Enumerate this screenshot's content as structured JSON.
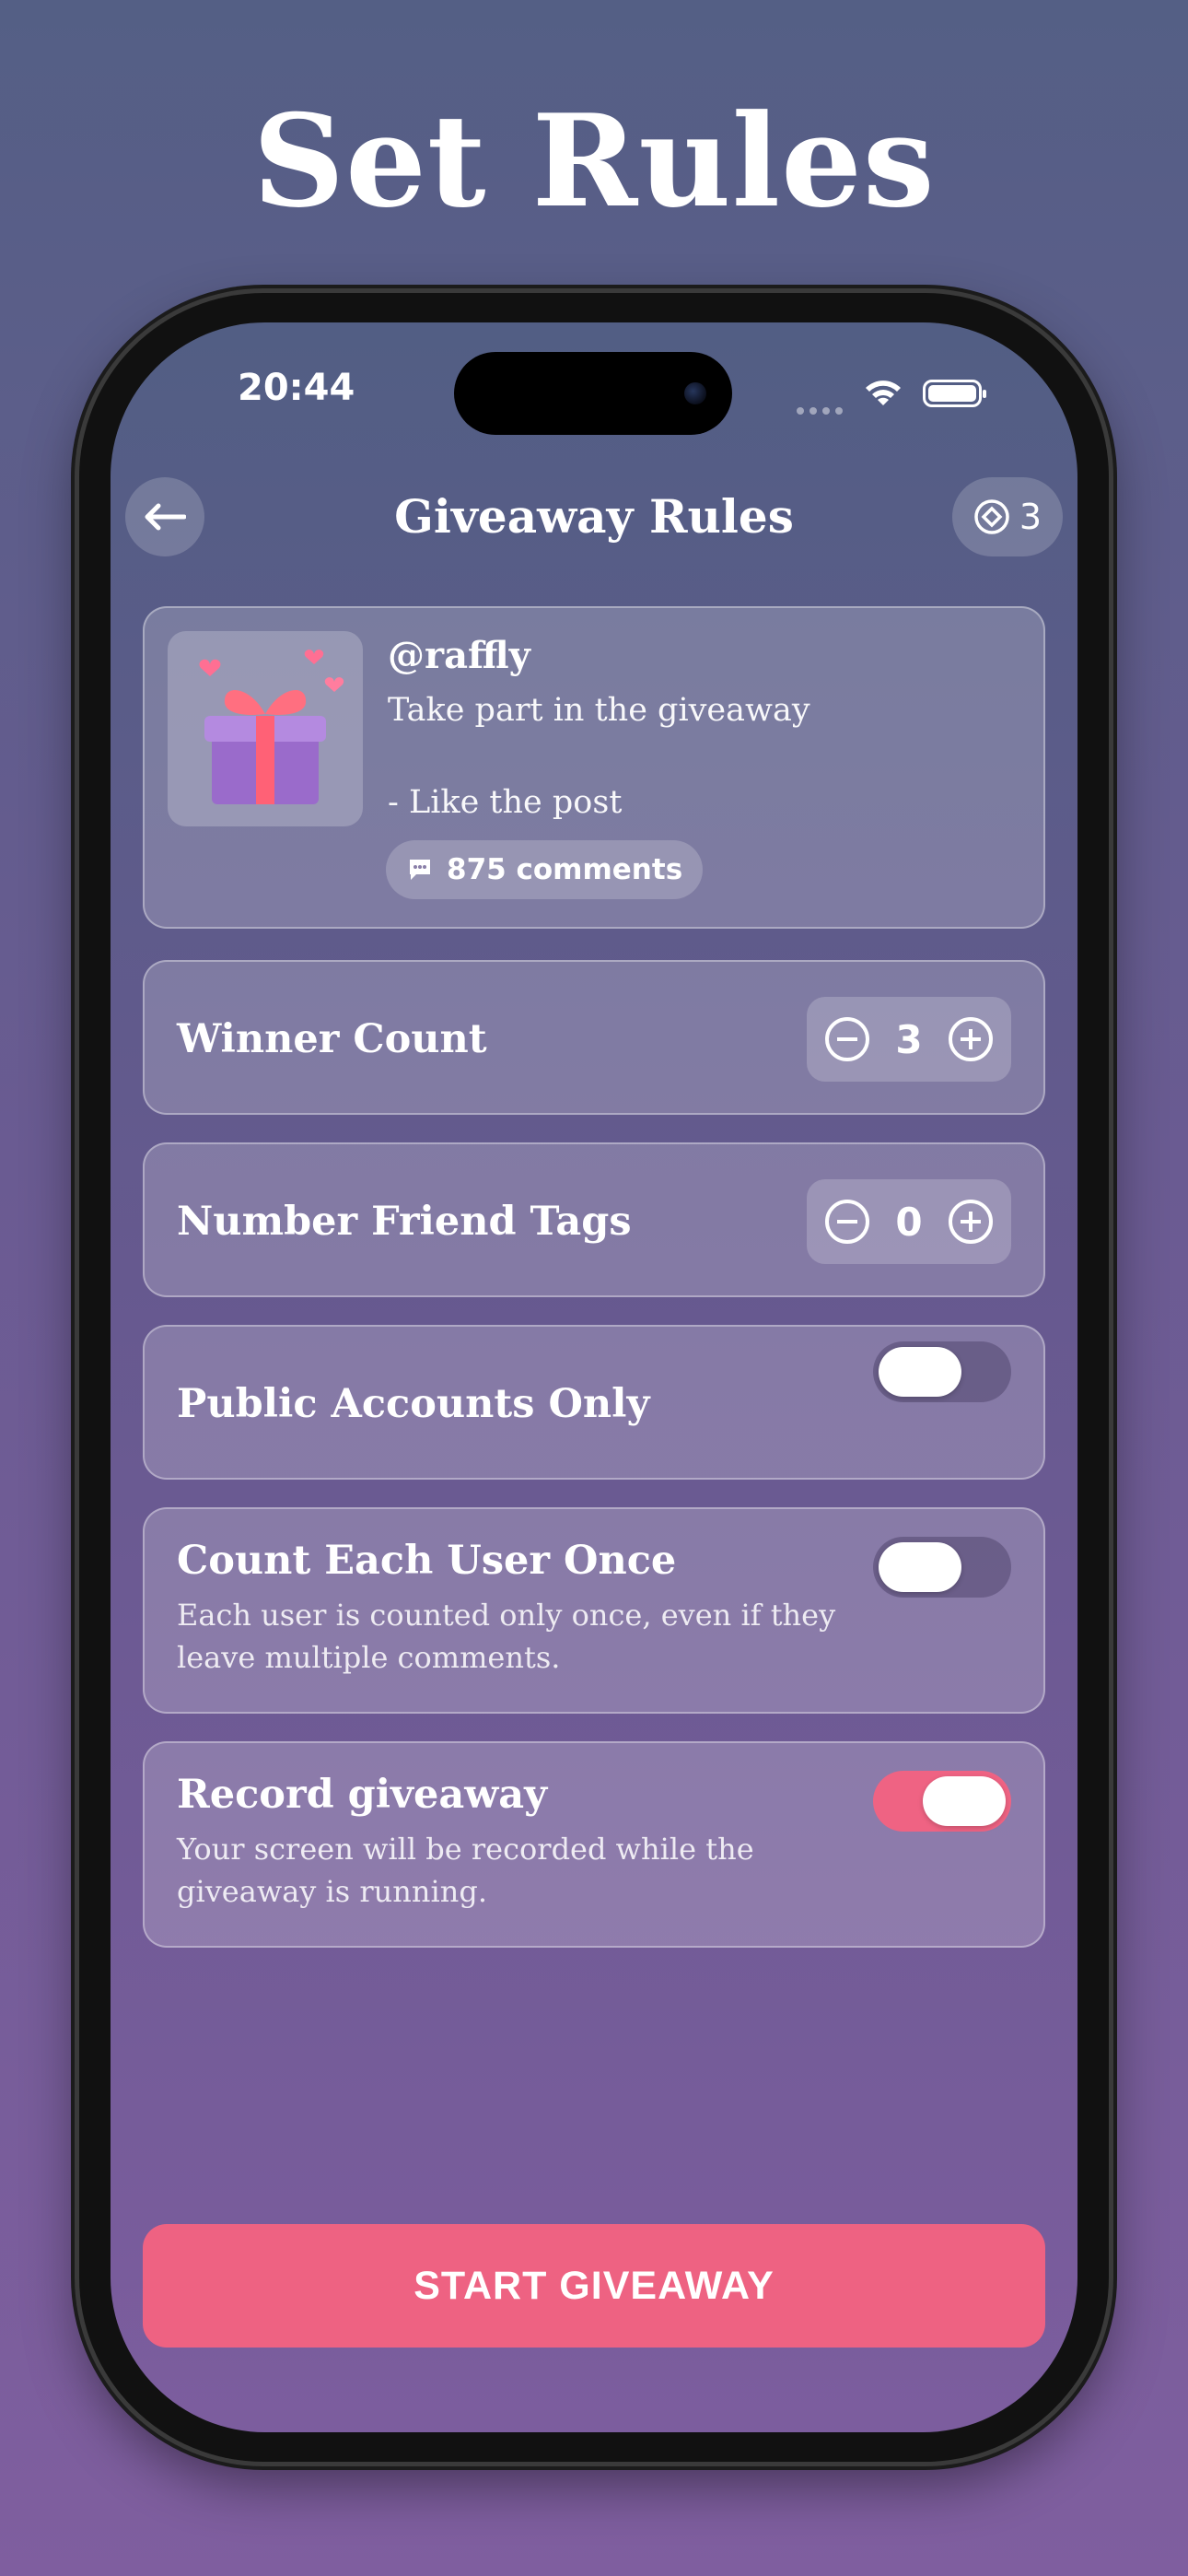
{
  "headline": "Set Rules",
  "status_bar": {
    "time": "20:44"
  },
  "nav": {
    "title": "Giveaway Rules",
    "credits": "3"
  },
  "post": {
    "handle": "@raffly",
    "caption": "Take part in the giveaway\n\n- Like the post",
    "comments": "875 comments"
  },
  "rules": {
    "winner_count": {
      "label": "Winner Count",
      "value": "3"
    },
    "friend_tags": {
      "label": "Number Friend Tags",
      "value": "0"
    },
    "public_only": {
      "label": "Public Accounts Only",
      "enabled": false
    },
    "count_once": {
      "label": "Count Each User Once",
      "description": "Each user is counted only once, even if they leave multiple comments.",
      "enabled": false
    },
    "record": {
      "label": "Record giveaway",
      "description": "Your screen will be recorded while the giveaway is running.",
      "enabled": true
    }
  },
  "cta": {
    "label": "START GIVEAWAY"
  },
  "colors": {
    "accent": "#ee6282",
    "bg_top": "#545f85",
    "bg_bottom": "#7f5e9f"
  }
}
